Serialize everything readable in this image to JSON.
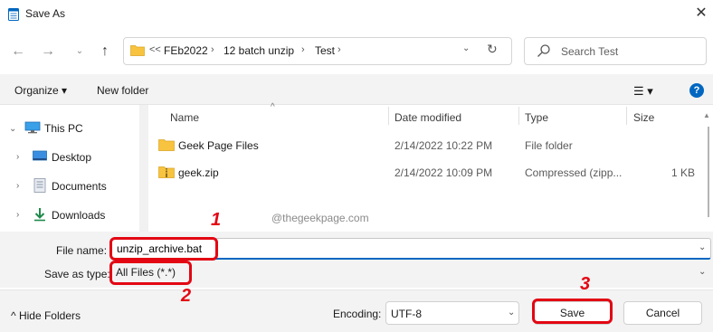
{
  "window": {
    "title": "Save As",
    "close_glyph": "✕"
  },
  "nav": {
    "back_glyph": "←",
    "forward_glyph": "→",
    "recent_glyph": "⌄",
    "up_glyph": "↑",
    "address_overflow": "<<",
    "breadcrumbs": [
      "FEb2022",
      "12 batch unzip",
      "Test"
    ],
    "crumb_separator": "›",
    "dropdown_glyph": "⌄",
    "refresh_glyph": "↻",
    "search_placeholder": "Search Test"
  },
  "toolbar": {
    "organize_label": "Organize ▾",
    "new_folder_label": "New folder",
    "view_glyph": "☰ ▾",
    "help_glyph": "?"
  },
  "sidebar": {
    "items": [
      {
        "label": "This PC",
        "chevron": "⌄",
        "icon": "pc-icon"
      },
      {
        "label": "Desktop",
        "chevron": "›",
        "icon": "desktop-icon"
      },
      {
        "label": "Documents",
        "chevron": "›",
        "icon": "documents-icon"
      },
      {
        "label": "Downloads",
        "chevron": "›",
        "icon": "downloads-icon"
      }
    ]
  },
  "filelist": {
    "sort_glyph": "^",
    "columns": [
      "Name",
      "Date modified",
      "Type",
      "Size"
    ],
    "rows": [
      {
        "name": "Geek Page Files",
        "date": "2/14/2022 10:22 PM",
        "type": "File folder",
        "size": "",
        "icon": "folder-icon"
      },
      {
        "name": "geek.zip",
        "date": "2/14/2022 10:09 PM",
        "type": "Compressed (zipp...",
        "size": "1 KB",
        "icon": "zip-folder-icon"
      }
    ],
    "watermark": "@thegeekpage.com",
    "scroll_up_glyph": "▲"
  },
  "form": {
    "file_name_label": "File name:",
    "file_name_value": "unzip_archive.bat",
    "save_type_label": "Save as type:",
    "save_type_value": "All Files  (*.*)",
    "dropdown_glyph": "⌄"
  },
  "footer": {
    "hide_folders_label": "^  Hide Folders",
    "encoding_label": "Encoding:",
    "encoding_value": "UTF-8",
    "save_label": "Save",
    "cancel_label": "Cancel"
  },
  "annotations": {
    "step1": "1",
    "step2": "2",
    "step3": "3",
    "color": "#e30613"
  },
  "colors": {
    "accent": "#0067c0",
    "folder": "#f8c33f",
    "toolbar_bg": "#f3f3f3"
  }
}
